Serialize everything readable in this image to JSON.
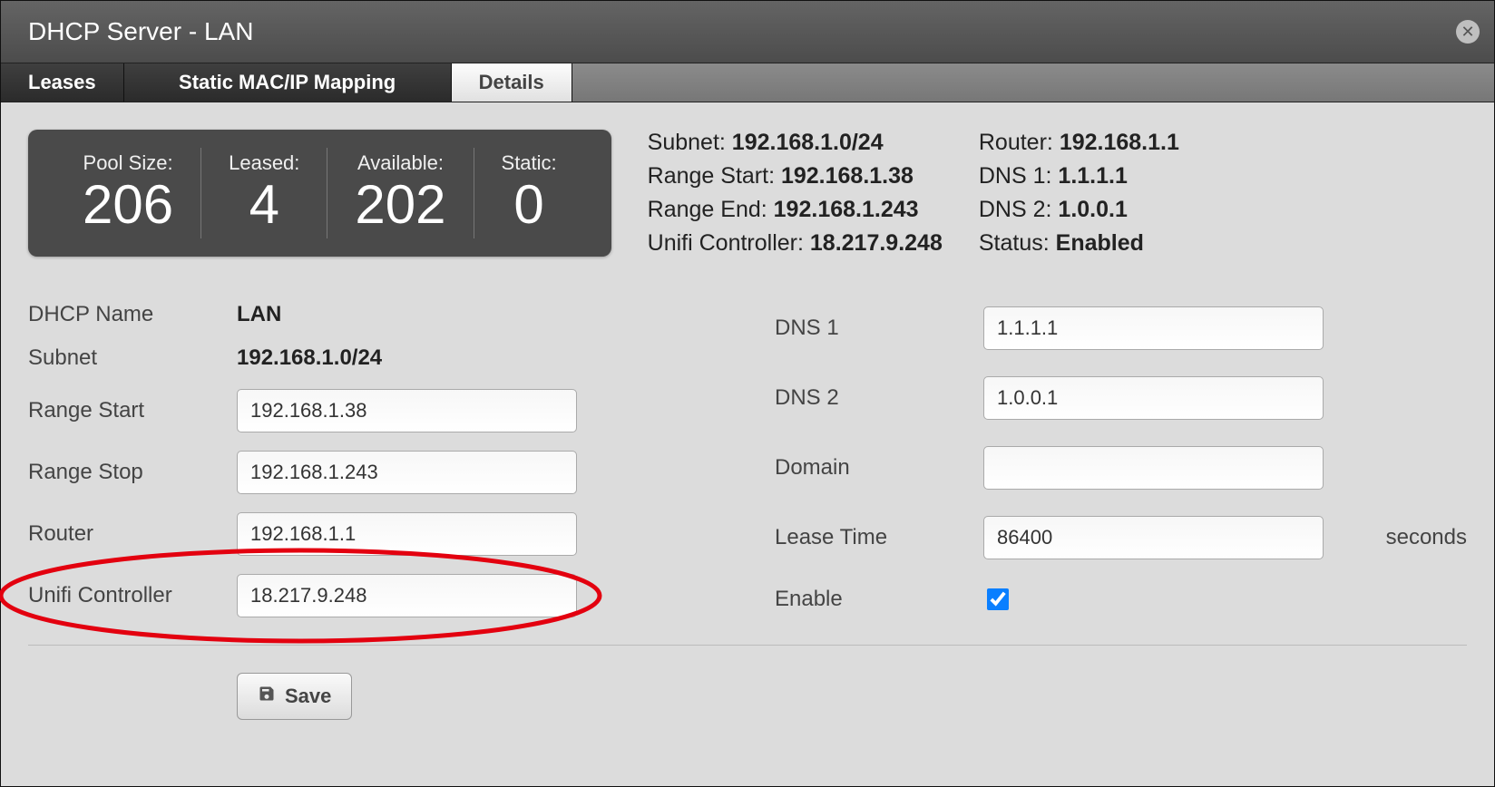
{
  "title": "DHCP Server - LAN",
  "tabs": {
    "leases": "Leases",
    "static": "Static MAC/IP Mapping",
    "details": "Details"
  },
  "stats": {
    "pool_label": "Pool Size:",
    "pool_val": "206",
    "leased_label": "Leased:",
    "leased_val": "4",
    "avail_label": "Available:",
    "avail_val": "202",
    "static_label": "Static:",
    "static_val": "0"
  },
  "summary_left": {
    "subnet_k": "Subnet:",
    "subnet_v": "192.168.1.0/24",
    "rstart_k": "Range Start:",
    "rstart_v": "192.168.1.38",
    "rend_k": "Range End:",
    "rend_v": "192.168.1.243",
    "unifi_k": "Unifi Controller:",
    "unifi_v": "18.217.9.248"
  },
  "summary_right": {
    "router_k": "Router:",
    "router_v": "192.168.1.1",
    "dns1_k": "DNS 1:",
    "dns1_v": "1.1.1.1",
    "dns2_k": "DNS 2:",
    "dns2_v": "1.0.0.1",
    "status_k": "Status:",
    "status_v": "Enabled"
  },
  "form_left": {
    "name_l": "DHCP Name",
    "name_v": "LAN",
    "subnet_l": "Subnet",
    "subnet_v": "192.168.1.0/24",
    "rstart_l": "Range Start",
    "rstart_v": "192.168.1.38",
    "rstop_l": "Range Stop",
    "rstop_v": "192.168.1.243",
    "router_l": "Router",
    "router_v": "192.168.1.1",
    "unifi_l": "Unifi Controller",
    "unifi_v": "18.217.9.248"
  },
  "form_right": {
    "dns1_l": "DNS 1",
    "dns1_v": "1.1.1.1",
    "dns2_l": "DNS 2",
    "dns2_v": "1.0.0.1",
    "domain_l": "Domain",
    "domain_v": "",
    "lease_l": "Lease Time",
    "lease_v": "86400",
    "lease_suffix": "seconds",
    "enable_l": "Enable"
  },
  "buttons": {
    "save": "Save"
  }
}
